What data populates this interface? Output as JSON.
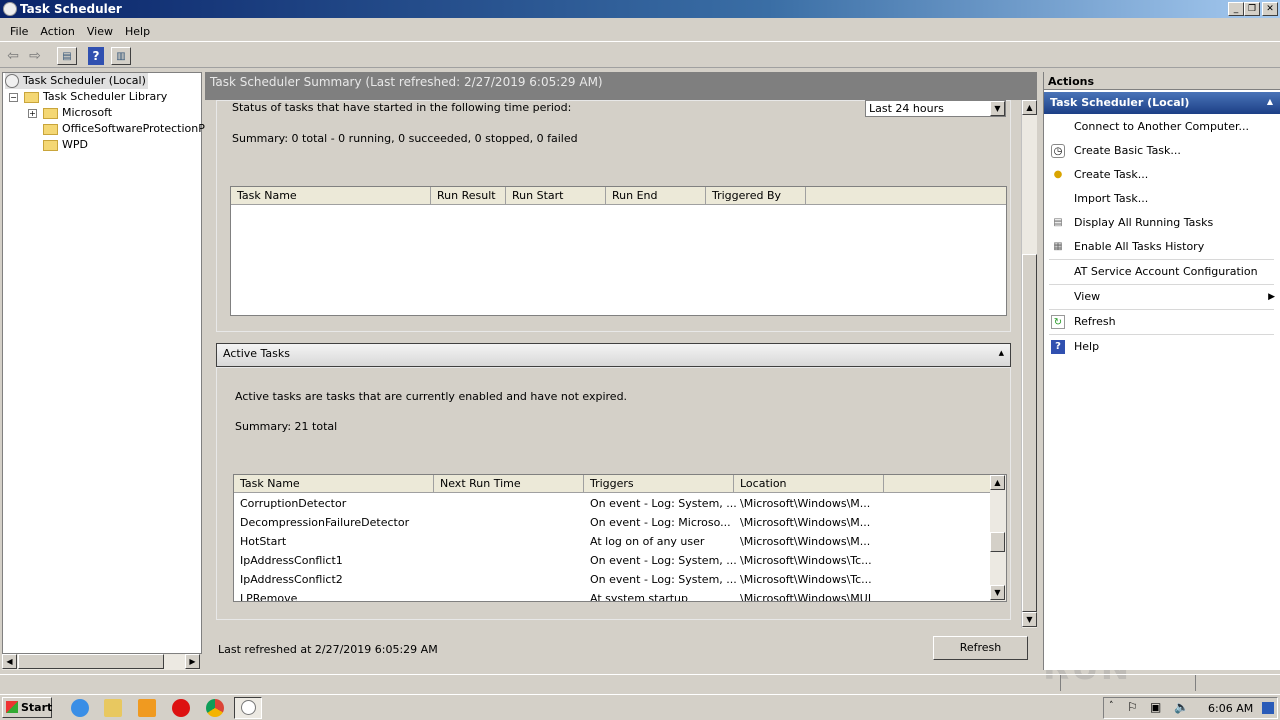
{
  "window": {
    "title": "Task Scheduler"
  },
  "menu": [
    "File",
    "Action",
    "View",
    "Help"
  ],
  "tree": {
    "root": "Task Scheduler (Local)",
    "library": "Task Scheduler Library",
    "folders": [
      "Microsoft",
      "OfficeSoftwareProtectionPla",
      "WPD"
    ]
  },
  "summary": {
    "header": "Task Scheduler Summary (Last refreshed: 2/27/2019 6:05:29 AM)",
    "status_label": "Status of tasks that have started in the following time period:",
    "period": "Last 24 hours",
    "summary_text": "Summary: 0 total - 0 running, 0 succeeded, 0 stopped, 0 failed",
    "status_columns": [
      "Task Name",
      "Run Result",
      "Run Start",
      "Run End",
      "Triggered By"
    ]
  },
  "active": {
    "title": "Active Tasks",
    "description": "Active tasks are tasks that are currently enabled and have not expired.",
    "summary": "Summary: 21 total",
    "columns": [
      "Task Name",
      "Next Run Time",
      "Triggers",
      "Location"
    ],
    "rows": [
      {
        "name": "CorruptionDetector",
        "next": "",
        "triggers": "On event - Log: System, ...",
        "location": "\\Microsoft\\Windows\\M..."
      },
      {
        "name": "DecompressionFailureDetector",
        "next": "",
        "triggers": "On event - Log: Microso...",
        "location": "\\Microsoft\\Windows\\M..."
      },
      {
        "name": "HotStart",
        "next": "",
        "triggers": "At log on of any user",
        "location": "\\Microsoft\\Windows\\M..."
      },
      {
        "name": "IpAddressConflict1",
        "next": "",
        "triggers": "On event - Log: System, ...",
        "location": "\\Microsoft\\Windows\\Tc..."
      },
      {
        "name": "IpAddressConflict2",
        "next": "",
        "triggers": "On event - Log: System, ...",
        "location": "\\Microsoft\\Windows\\Tc..."
      },
      {
        "name": "LPRemove",
        "next": "",
        "triggers": "At system startup",
        "location": "\\Microsoft\\Windows\\MUI"
      }
    ]
  },
  "footer": {
    "last_refreshed": "Last refreshed at 2/27/2019 6:05:29 AM",
    "refresh_button": "Refresh"
  },
  "actions": {
    "title": "Actions",
    "section": "Task Scheduler (Local)",
    "items": [
      "Connect to Another Computer...",
      "Create Basic Task...",
      "Create Task...",
      "Import Task...",
      "Display All Running Tasks",
      "Enable All Tasks History",
      "AT Service Account Configuration",
      "View",
      "Refresh",
      "Help"
    ]
  },
  "taskbar": {
    "start": "Start",
    "clock": "6:06 AM"
  },
  "watermark": "ANY RUN"
}
